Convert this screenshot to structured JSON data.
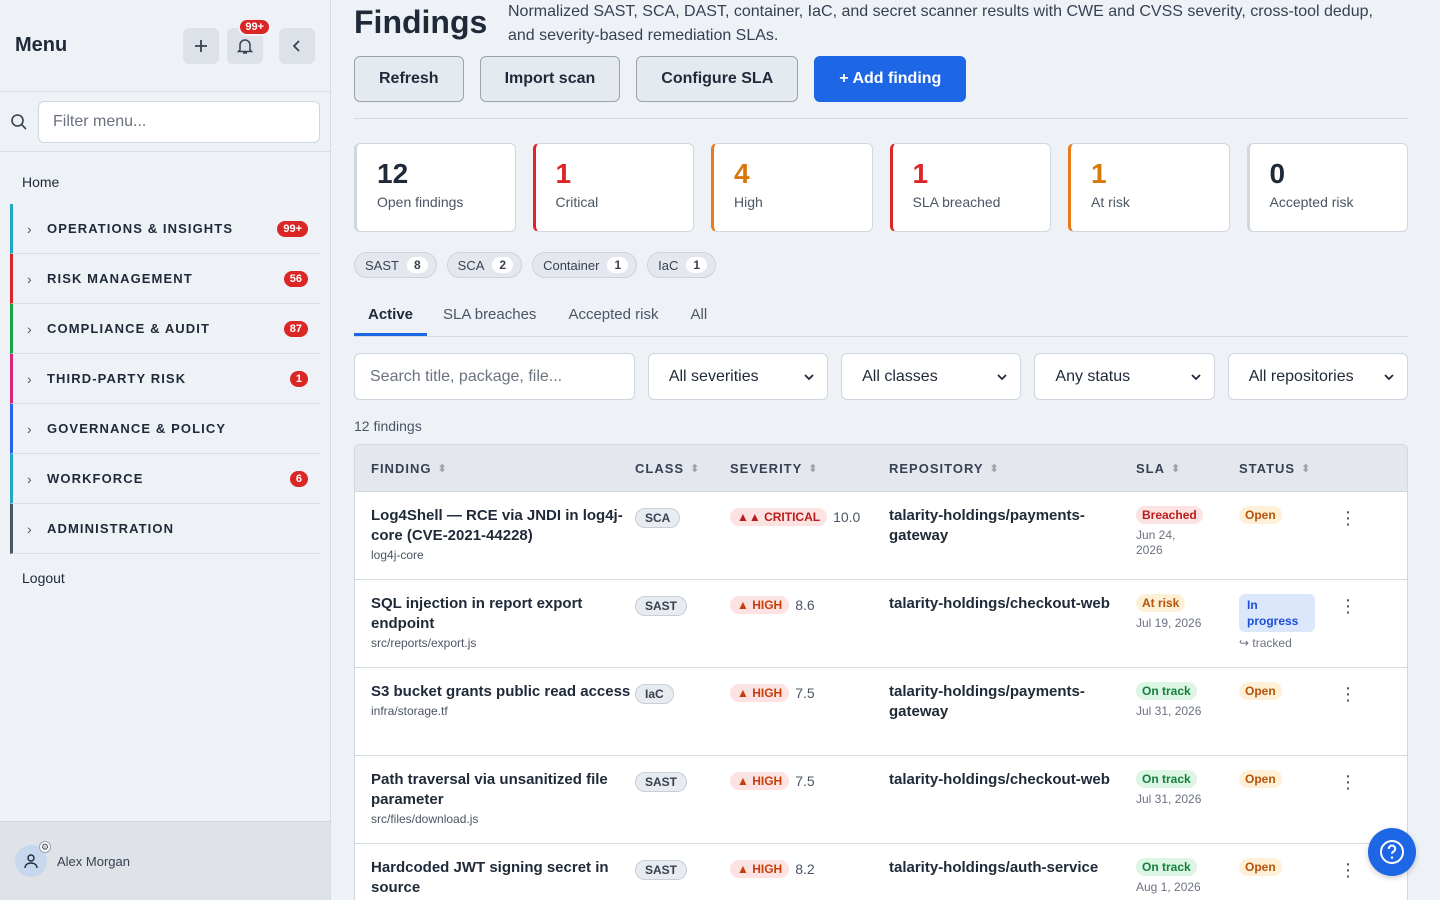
{
  "sidebar": {
    "title": "Menu",
    "notif_badge": "99+",
    "filter_placeholder": "Filter menu...",
    "home": "Home",
    "groups": [
      {
        "label": "OPERATIONS & INSIGHTS",
        "count": "99+",
        "color": "#22a6c6"
      },
      {
        "label": "RISK MANAGEMENT",
        "count": "56",
        "color": "#dc2626"
      },
      {
        "label": "COMPLIANCE & AUDIT",
        "count": "87",
        "color": "#16a34a"
      },
      {
        "label": "THIRD-PARTY RISK",
        "count": "1",
        "color": "#db2777"
      },
      {
        "label": "GOVERNANCE & POLICY",
        "count": "",
        "color": "#2563eb"
      },
      {
        "label": "WORKFORCE",
        "count": "6",
        "color": "#22a6c6"
      },
      {
        "label": "ADMINISTRATION",
        "count": "",
        "color": "#4b5563"
      }
    ],
    "logout": "Logout",
    "user": "Alex Morgan"
  },
  "header": {
    "title": "Findings",
    "subtitle": "Normalized SAST, SCA, DAST, container, IaC, and secret scanner results with CWE and CVSS severity, cross-tool dedup, and severity-based remediation SLAs.",
    "buttons": {
      "refresh": "Refresh",
      "import": "Import scan",
      "configure": "Configure SLA",
      "add": "+ Add finding"
    }
  },
  "stats": [
    {
      "value": "12",
      "label": "Open findings",
      "color": "#1f2937",
      "border": "#d1d7df"
    },
    {
      "value": "1",
      "label": "Critical",
      "color": "#dc2626",
      "border": "#dc2626"
    },
    {
      "value": "4",
      "label": "High",
      "color": "#d97706",
      "border": "#ea7a1a"
    },
    {
      "value": "1",
      "label": "SLA breached",
      "color": "#dc2626",
      "border": "#dc2626"
    },
    {
      "value": "1",
      "label": "At risk",
      "color": "#d97706",
      "border": "#ea7a1a"
    },
    {
      "value": "0",
      "label": "Accepted risk",
      "color": "#1f2937",
      "border": "#d1d7df"
    }
  ],
  "chips": [
    {
      "label": "SAST",
      "count": "8"
    },
    {
      "label": "SCA",
      "count": "2"
    },
    {
      "label": "Container",
      "count": "1"
    },
    {
      "label": "IaC",
      "count": "1"
    }
  ],
  "tabs": [
    "Active",
    "SLA breaches",
    "Accepted risk",
    "All"
  ],
  "filters": {
    "search_placeholder": "Search title, package, file...",
    "severity": "All severities",
    "class": "All classes",
    "status": "Any status",
    "repo": "All repositories"
  },
  "count_text": "12 findings",
  "columns": {
    "finding": "FINDING",
    "class": "CLASS",
    "severity": "SEVERITY",
    "repository": "REPOSITORY",
    "sla": "SLA",
    "status": "STATUS"
  },
  "rows": [
    {
      "title": "Log4Shell — RCE via JNDI in log4j-core (CVE-2021-44228)",
      "sub": "log4j-core",
      "class": "SCA",
      "severity": "CRITICAL",
      "score": "10.0",
      "repo": "talarity-holdings/payments-gateway",
      "sla": "Breached",
      "sla_date": "Jun 24, 2026",
      "status": "Open",
      "tracked": ""
    },
    {
      "title": "SQL injection in report export endpoint",
      "sub": "src/reports/export.js",
      "class": "SAST",
      "severity": "HIGH",
      "score": "8.6",
      "repo": "talarity-holdings/checkout-web",
      "sla": "At risk",
      "sla_date": "Jul 19, 2026",
      "status": "In progress",
      "tracked": "↪ tracked"
    },
    {
      "title": "S3 bucket grants public read access",
      "sub": "infra/storage.tf",
      "class": "IaC",
      "severity": "HIGH",
      "score": "7.5",
      "repo": "talarity-holdings/payments-gateway",
      "sla": "On track",
      "sla_date": "Jul 31, 2026",
      "status": "Open",
      "tracked": ""
    },
    {
      "title": "Path traversal via unsanitized file parameter",
      "sub": "src/files/download.js",
      "class": "SAST",
      "severity": "HIGH",
      "score": "7.5",
      "repo": "talarity-holdings/checkout-web",
      "sla": "On track",
      "sla_date": "Jul 31, 2026",
      "status": "Open",
      "tracked": ""
    },
    {
      "title": "Hardcoded JWT signing secret in source",
      "sub": "",
      "class": "SAST",
      "severity": "HIGH",
      "score": "8.2",
      "repo": "talarity-holdings/auth-service",
      "sla": "On track",
      "sla_date": "Aug 1, 2026",
      "status": "Open",
      "tracked": ""
    }
  ]
}
